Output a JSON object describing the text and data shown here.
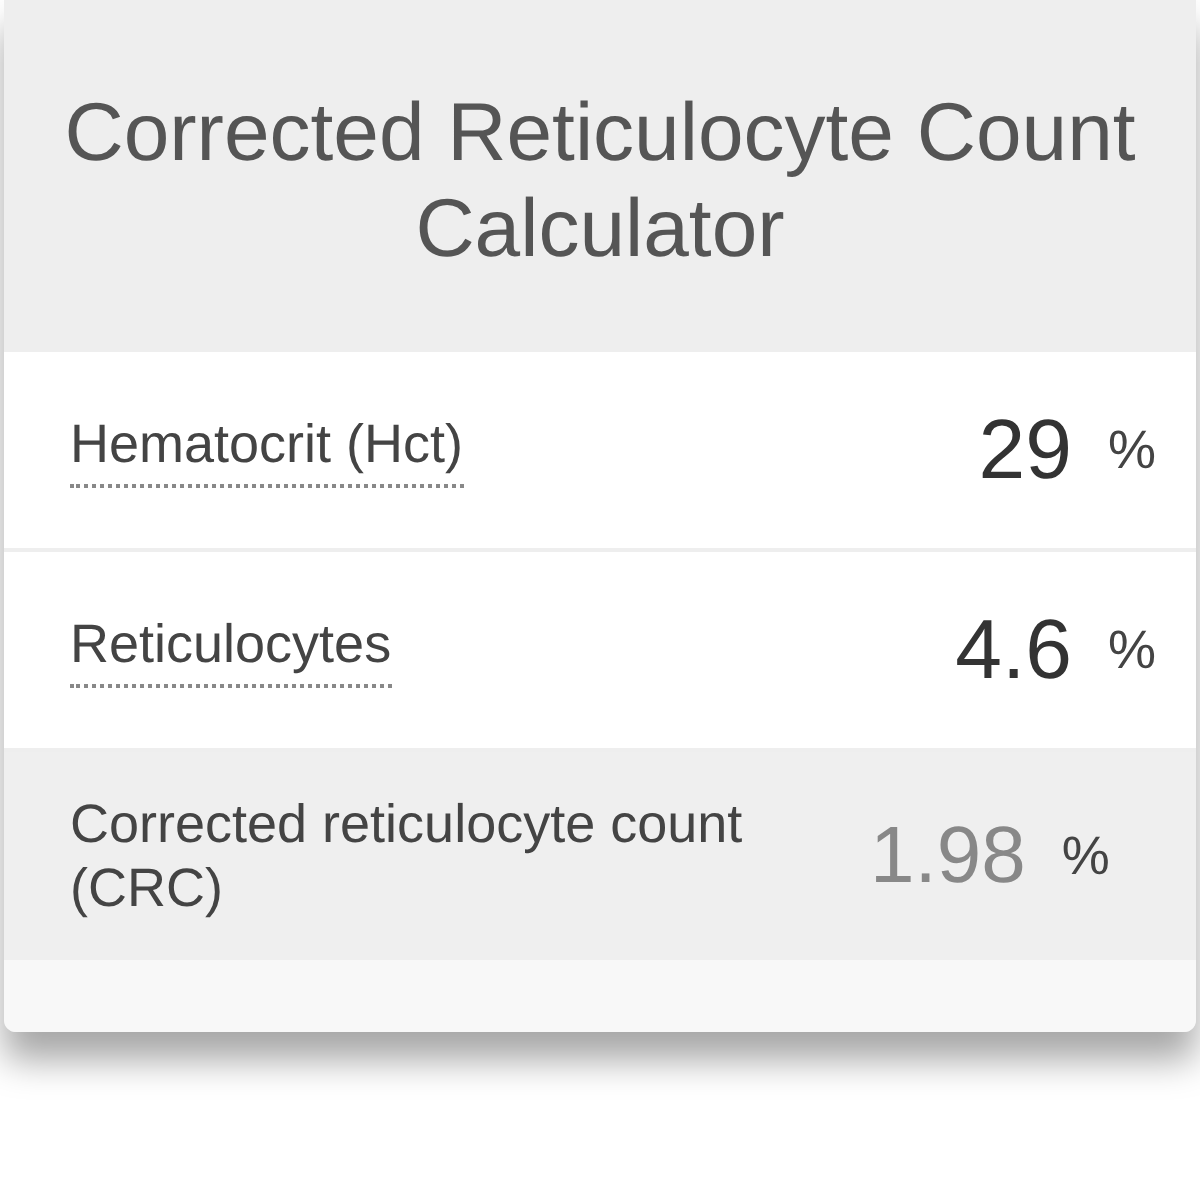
{
  "title": "Corrected Reticulocyte Count Calculator",
  "fields": [
    {
      "kind": "input",
      "label": "Hematocrit (Hct)",
      "value": "29",
      "unit": "%"
    },
    {
      "kind": "input",
      "label": "Reticulocytes",
      "value": "4.6",
      "unit": "%"
    },
    {
      "kind": "output",
      "label": "Corrected reticulocyte count (CRC)",
      "value": "1.98",
      "unit": "%"
    }
  ]
}
